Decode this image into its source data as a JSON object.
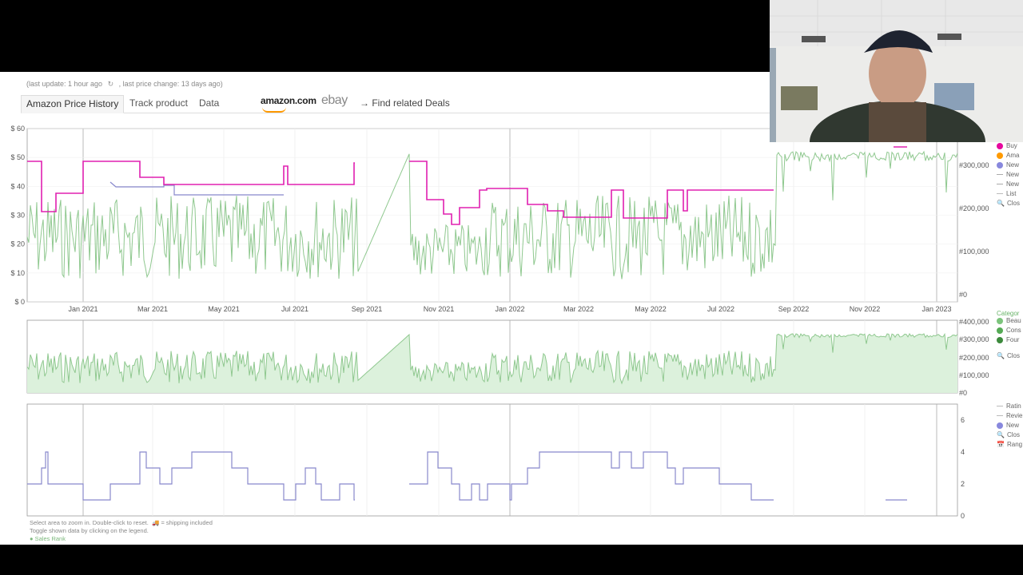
{
  "header": {
    "last_update": "(last update: 1 hour ago",
    "last_price_change": ", last price change: 13 days ago)"
  },
  "tabs": [
    {
      "label": "Amazon Price History",
      "active": true
    },
    {
      "label": "Track product",
      "active": false
    },
    {
      "label": "Data",
      "active": false
    }
  ],
  "logos": {
    "amazon": "amazon.com",
    "ebay": "ebay"
  },
  "deals_link": "→ Find related Deals",
  "charts": {
    "price_axis": [
      "$ 60",
      "$ 50",
      "$ 40",
      "$ 30",
      "$ 20",
      "$ 10",
      "$ 0"
    ],
    "rank_axis_right": [
      "#300,000",
      "#200,000",
      "#100,000",
      "#0"
    ],
    "date_labels": [
      "Jan 2021",
      "Mar 2021",
      "May 2021",
      "Jul 2021",
      "Sep 2021",
      "Nov 2021",
      "Jan 2022",
      "Mar 2022",
      "May 2022",
      "Jul 2022",
      "Sep 2022",
      "Nov 2022",
      "Jan 2023"
    ],
    "rank_panel_axis": [
      "#400,000",
      "#300,000",
      "#200,000",
      "#100,000",
      "#0"
    ],
    "offers_axis": [
      "6",
      "4",
      "2",
      "0"
    ],
    "colors": {
      "buy_box": "#e020b0",
      "new": "#8888cc",
      "sales_rank": "#8fc88f",
      "sales_fill": "#d9f0d9"
    }
  },
  "legend_main": [
    {
      "label": "Buy",
      "color": "#e6079e",
      "shape": "dot"
    },
    {
      "label": "Ama",
      "color": "#ff9a00",
      "shape": "dot"
    },
    {
      "label": "New",
      "color": "#8888dd",
      "shape": "dot"
    },
    {
      "label": "New",
      "color": "#aaaaaa",
      "shape": "line"
    },
    {
      "label": "New",
      "color": "#aaaaaa",
      "shape": "line"
    },
    {
      "label": "List",
      "color": "#bbbbbb",
      "shape": "line"
    },
    {
      "label": "Clos",
      "color": "#333333",
      "shape": "search"
    }
  ],
  "legend_category": {
    "title": "Categor",
    "items": [
      {
        "label": "Beau",
        "color": "#7cc47c"
      },
      {
        "label": "Cons",
        "color": "#55aa55"
      },
      {
        "label": "Four",
        "color": "#3d8a3d"
      }
    ],
    "close": "Clos"
  },
  "legend_offers": [
    {
      "label": "Ratin",
      "color": "#bbbbbb",
      "shape": "line"
    },
    {
      "label": "Revie",
      "color": "#bbbbbb",
      "shape": "line"
    },
    {
      "label": "New",
      "color": "#8888dd",
      "shape": "dot"
    },
    {
      "label": "Clos",
      "color": "#333333",
      "shape": "search"
    },
    {
      "label": "Rang",
      "color": "#333333",
      "shape": "calendar"
    }
  ],
  "footer": {
    "line1": "Select area to zoom in. Double-click to reset.",
    "shipping": "= shipping included",
    "line2": "Toggle shown data by clicking on the legend.",
    "line3": "● Sales Rank"
  }
}
